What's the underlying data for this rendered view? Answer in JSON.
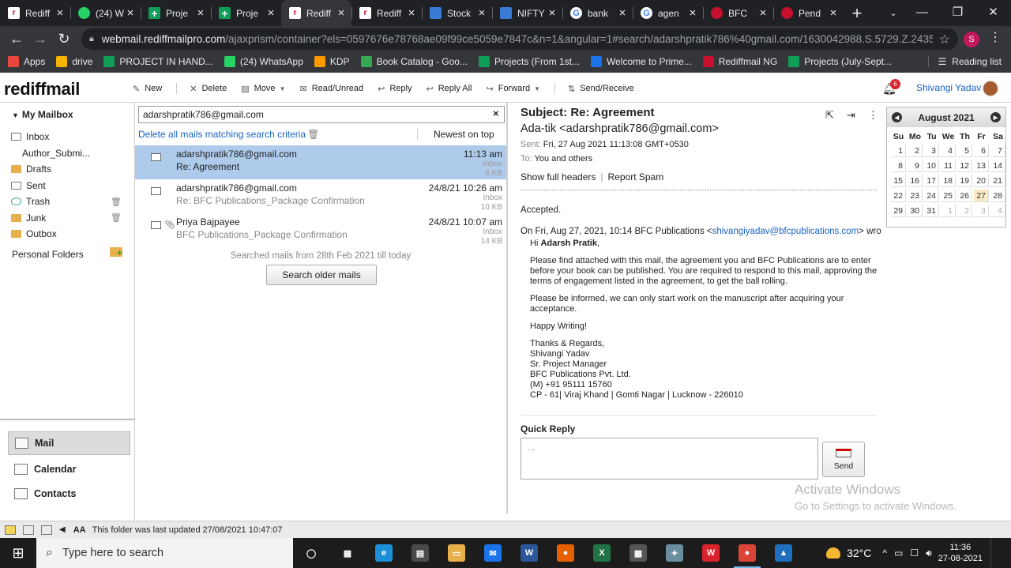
{
  "browser": {
    "tabs": [
      {
        "label": "Rediff",
        "icon": "rediff-favicon",
        "active": false
      },
      {
        "label": "(24) W",
        "icon": "whatsapp-favicon",
        "active": false
      },
      {
        "label": "Proje",
        "icon": "sheets-favicon",
        "active": false
      },
      {
        "label": "Proje",
        "icon": "sheets-favicon",
        "active": false
      },
      {
        "label": "Rediff",
        "icon": "rediff-favicon",
        "active": true
      },
      {
        "label": "Rediff",
        "icon": "rediff-favicon",
        "active": false
      },
      {
        "label": "Stock",
        "icon": "stock-favicon",
        "active": false
      },
      {
        "label": "NIFTY",
        "icon": "stock-favicon",
        "active": false
      },
      {
        "label": "bank",
        "icon": "google-favicon",
        "active": false
      },
      {
        "label": "agen",
        "icon": "google-favicon",
        "active": false
      },
      {
        "label": "BFC",
        "icon": "bfc-favicon",
        "active": false
      },
      {
        "label": "Pend",
        "icon": "bfc-favicon",
        "active": false
      }
    ],
    "url_host": "webmail.rediffmailpro.com",
    "url_rest": "/ajaxprism/container?els=0597676e78768ae09f99ce5059e7847c&n=1&angular=1#search/adarshpratik786%40gmail.com/1630042988.S.5729.Z.24353....",
    "profile_initial": "S",
    "bookmarks": [
      {
        "label": "Apps",
        "icon": "apps-grid-icon",
        "color": "#e8453c"
      },
      {
        "label": "drive",
        "icon": "drive-icon",
        "color": "#f4b400"
      },
      {
        "label": "PROJECT IN HAND...",
        "icon": "sheets-icon",
        "color": "#0f9d58"
      },
      {
        "label": "(24) WhatsApp",
        "icon": "whatsapp-icon",
        "color": "#25d366"
      },
      {
        "label": "KDP",
        "icon": "amazon-icon",
        "color": "#ff9900"
      },
      {
        "label": "Book Catalog - Goo...",
        "icon": "play-icon",
        "color": "#34a853"
      },
      {
        "label": "Projects (From 1st...",
        "icon": "sheets-icon",
        "color": "#0f9d58"
      },
      {
        "label": "Welcome to Prime...",
        "icon": "prime-icon",
        "color": "#1a73e8"
      },
      {
        "label": "Rediffmail NG",
        "icon": "rediff-icon",
        "color": "#c8102e"
      },
      {
        "label": "Projects (July-Sept...",
        "icon": "sheets-icon",
        "color": "#0f9d58"
      }
    ],
    "reading_list": "Reading list"
  },
  "app": {
    "logo": "rediffmail",
    "actions": [
      {
        "label": "New",
        "icon": "compose-icon",
        "caret": false
      },
      {
        "label": "Delete",
        "icon": "delete-x-icon",
        "caret": false
      },
      {
        "label": "Move",
        "icon": "move-icon",
        "caret": true
      },
      {
        "label": "Read/Unread",
        "icon": "envelope-icon",
        "caret": false
      },
      {
        "label": "Reply",
        "icon": "reply-icon",
        "caret": false
      },
      {
        "label": "Reply All",
        "icon": "reply-all-icon",
        "caret": false
      },
      {
        "label": "Forward",
        "icon": "forward-icon",
        "caret": true
      },
      {
        "label": "Send/Receive",
        "icon": "send-receive-icon",
        "caret": false
      }
    ],
    "notifications": "6",
    "user_name": "Shivangi Yadav"
  },
  "sidebar": {
    "title": "My Mailbox",
    "folders": [
      {
        "label": "Inbox",
        "indent": false,
        "bin": false
      },
      {
        "label": "Author_Submi...",
        "indent": true,
        "bin": false
      },
      {
        "label": "Drafts",
        "indent": false,
        "bin": false
      },
      {
        "label": "Sent",
        "indent": false,
        "bin": false
      },
      {
        "label": "Trash",
        "indent": false,
        "bin": true
      },
      {
        "label": "Junk",
        "indent": false,
        "bin": true
      },
      {
        "label": "Outbox",
        "indent": false,
        "bin": false
      }
    ],
    "personal_folders": "Personal Folders",
    "modules": [
      "Mail",
      "Calendar",
      "Contacts"
    ]
  },
  "list": {
    "search_value": "adarshpratik786@gmail.com",
    "delete_all": "Delete all mails matching search criteria",
    "sort": "Newest on top",
    "mails": [
      {
        "from": "adarshpratik786@gmail.com",
        "subject": "Re: Agreement",
        "date": "11:13 am",
        "folder": "Inbox",
        "size": "6 KB",
        "attachment": false,
        "selected": true
      },
      {
        "from": "adarshpratik786@gmail.com",
        "subject": "Re: BFC Publications_Package Confirmation",
        "date": "24/8/21 10:26 am",
        "folder": "Inbox",
        "size": "10 KB",
        "attachment": false,
        "selected": false
      },
      {
        "from": "Priya Bajpayee",
        "subject": "BFC Publications_Package Confirmation",
        "date": "24/8/21 10:07 am",
        "folder": "Inbox",
        "size": "14 KB",
        "attachment": true,
        "selected": false
      }
    ],
    "searched_note": "Searched mails from 28th Feb 2021 till today",
    "older_button": "Search older mails"
  },
  "message": {
    "subject": "Subject: Re: Agreement",
    "sender": "Ada-tik <adarshpratik786@gmail.com>",
    "sent_label": "Sent:",
    "sent_value": "Fri, 27 Aug 2021 11:13:08 GMT+0530",
    "to_label": "To:",
    "to_value": "You and others",
    "show_headers": "Show full headers",
    "report_spam": "Report Spam",
    "body_first": "Accepted.",
    "quote_intro": "On Fri, Aug 27, 2021, 10:14 BFC Publications <",
    "quote_email": "shivangiyadav@bfcpublications.com",
    "quote_intro_end": "> wrote:",
    "greeting_prefix": "Hi ",
    "greeting_name": "Adarsh Pratik",
    "greeting_suffix": ",",
    "para1": "Please find attached with this mail, the agreement you and BFC Publications are to enter before your book can be published. You are required to respond to this mail, approving the terms of engagement listed in the agreement, to get the ball rolling.",
    "para2": "Please be informed, we can only start work on the manuscript after acquiring your acceptance.",
    "para3": "Happy Writing!",
    "sig": [
      "Thanks & Regards,",
      "Shivangi Yadav",
      "Sr. Project Manager",
      "BFC Publications Pvt. Ltd.",
      "(M) +91 95111 15760",
      "CP - 61| Viraj Khand | Gomti Nagar | Lucknow - 226010"
    ],
    "quick_reply_label": "Quick Reply",
    "quick_reply_placeholder": "...",
    "send_label": "Send"
  },
  "calendar": {
    "month": "August 2021",
    "weekdays": [
      "Su",
      "Mo",
      "Tu",
      "We",
      "Th",
      "Fr",
      "Sa"
    ],
    "days": [
      {
        "d": "1",
        "cur": true
      },
      {
        "d": "2",
        "cur": true
      },
      {
        "d": "3",
        "cur": true
      },
      {
        "d": "4",
        "cur": true
      },
      {
        "d": "5",
        "cur": true
      },
      {
        "d": "6",
        "cur": true
      },
      {
        "d": "7",
        "cur": true
      },
      {
        "d": "8",
        "cur": true
      },
      {
        "d": "9",
        "cur": true
      },
      {
        "d": "10",
        "cur": true
      },
      {
        "d": "11",
        "cur": true
      },
      {
        "d": "12",
        "cur": true
      },
      {
        "d": "13",
        "cur": true
      },
      {
        "d": "14",
        "cur": true
      },
      {
        "d": "15",
        "cur": true
      },
      {
        "d": "16",
        "cur": true
      },
      {
        "d": "17",
        "cur": true
      },
      {
        "d": "18",
        "cur": true
      },
      {
        "d": "19",
        "cur": true
      },
      {
        "d": "20",
        "cur": true
      },
      {
        "d": "21",
        "cur": true
      },
      {
        "d": "22",
        "cur": true
      },
      {
        "d": "23",
        "cur": true
      },
      {
        "d": "24",
        "cur": true
      },
      {
        "d": "25",
        "cur": true
      },
      {
        "d": "26",
        "cur": true
      },
      {
        "d": "27",
        "cur": true,
        "today": true
      },
      {
        "d": "28",
        "cur": true
      },
      {
        "d": "29",
        "cur": true
      },
      {
        "d": "30",
        "cur": true
      },
      {
        "d": "31",
        "cur": true
      },
      {
        "d": "1",
        "cur": false
      },
      {
        "d": "2",
        "cur": false
      },
      {
        "d": "3",
        "cur": false
      },
      {
        "d": "4",
        "cur": false
      }
    ]
  },
  "watermark": {
    "line1": "Activate Windows",
    "line2": "Go to Settings to activate Windows."
  },
  "status": {
    "text": "This folder was last updated 27/08/2021 10:47:07"
  },
  "taskbar": {
    "search_placeholder": "Type here to search",
    "apps": [
      {
        "name": "task-view-icon",
        "glyph": "◯",
        "color": "transparent",
        "active": false
      },
      {
        "name": "widgets-icon",
        "glyph": "▦",
        "color": "transparent",
        "active": false
      },
      {
        "name": "edge-icon",
        "glyph": "e",
        "color": "#1b8fd8",
        "active": false
      },
      {
        "name": "store-icon",
        "glyph": "▤",
        "color": "#4a4a4a",
        "active": false
      },
      {
        "name": "file-explorer-icon",
        "glyph": "▭",
        "color": "#e8b04a",
        "active": false
      },
      {
        "name": "mail-icon",
        "glyph": "✉",
        "color": "#1a73e8",
        "active": false
      },
      {
        "name": "word-icon",
        "glyph": "W",
        "color": "#2b579a",
        "active": false
      },
      {
        "name": "firefox-icon",
        "glyph": "●",
        "color": "#e66000",
        "active": false
      },
      {
        "name": "excel-icon",
        "glyph": "X",
        "color": "#217346",
        "active": false
      },
      {
        "name": "calculator-icon",
        "glyph": "▦",
        "color": "#555",
        "active": false
      },
      {
        "name": "app-icon",
        "glyph": "✦",
        "color": "#6b8e9e",
        "active": false
      },
      {
        "name": "wps-icon",
        "glyph": "W",
        "color": "#d9232d",
        "active": false
      },
      {
        "name": "chrome-icon",
        "glyph": "●",
        "color": "#db4437",
        "active": true
      },
      {
        "name": "photos-icon",
        "glyph": "▲",
        "color": "#1e6fbf",
        "active": false
      }
    ],
    "temperature": "32°C",
    "time": "11:36",
    "date": "27-08-2021"
  }
}
